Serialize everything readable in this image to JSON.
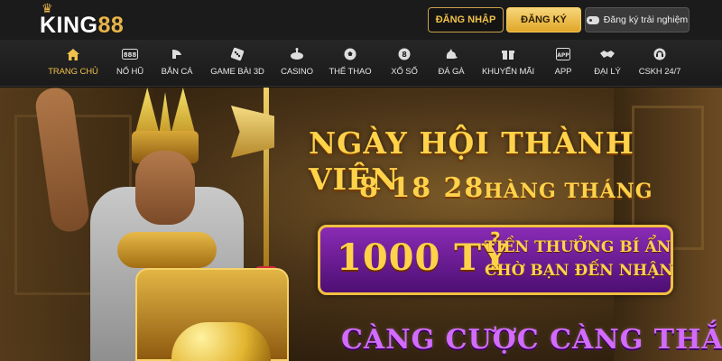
{
  "header": {
    "logo": {
      "prefix": "KING",
      "suffix": "88"
    },
    "login_label": "ĐĂNG NHẬP",
    "register_label": "ĐĂNG KÝ",
    "trial_label": "Đăng ký trải nghiệm"
  },
  "nav": {
    "items": [
      {
        "label": "TRANG CHỦ",
        "icon": "home-icon",
        "active": true
      },
      {
        "label": "NỔ HŨ",
        "icon": "slot-machine-icon"
      },
      {
        "label": "BẮN CÁ",
        "icon": "fish-icon"
      },
      {
        "label": "GAME BÀI 3D",
        "icon": "dice-icon"
      },
      {
        "label": "CASINO",
        "icon": "roulette-icon"
      },
      {
        "label": "THỂ THAO",
        "icon": "soccer-ball-icon"
      },
      {
        "label": "XỔ SỐ",
        "icon": "lottery-ball-icon"
      },
      {
        "label": "ĐÁ GÀ",
        "icon": "rooster-icon"
      },
      {
        "label": "KHUYẾN MÃI",
        "icon": "gift-icon"
      },
      {
        "label": "APP",
        "icon": "app-icon"
      },
      {
        "label": "ĐẠI LÝ",
        "icon": "handshake-icon"
      },
      {
        "label": "CSKH 24/7",
        "icon": "support-icon"
      }
    ]
  },
  "banner": {
    "headline": "NGÀY HỘI THÀNH VIÊN",
    "dates": "8 18 28",
    "dates_suffix": "HÀNG THÁNG",
    "prize_amount": "1000 TỶ",
    "prize_line1": "TIỀN THƯỞNG BÍ ẨN",
    "prize_line2": "CHỜ BẠN ĐẾN NHẬN",
    "slogan": "CÀNG CƯỢC CÀNG THẮNG"
  },
  "colors": {
    "gold": "#f0c14b",
    "banner_text": "#ffd24a",
    "prize_purple": "#8a2bb5",
    "slogan_purple": "#d46bff",
    "header_bg": "#1b1b1b"
  }
}
